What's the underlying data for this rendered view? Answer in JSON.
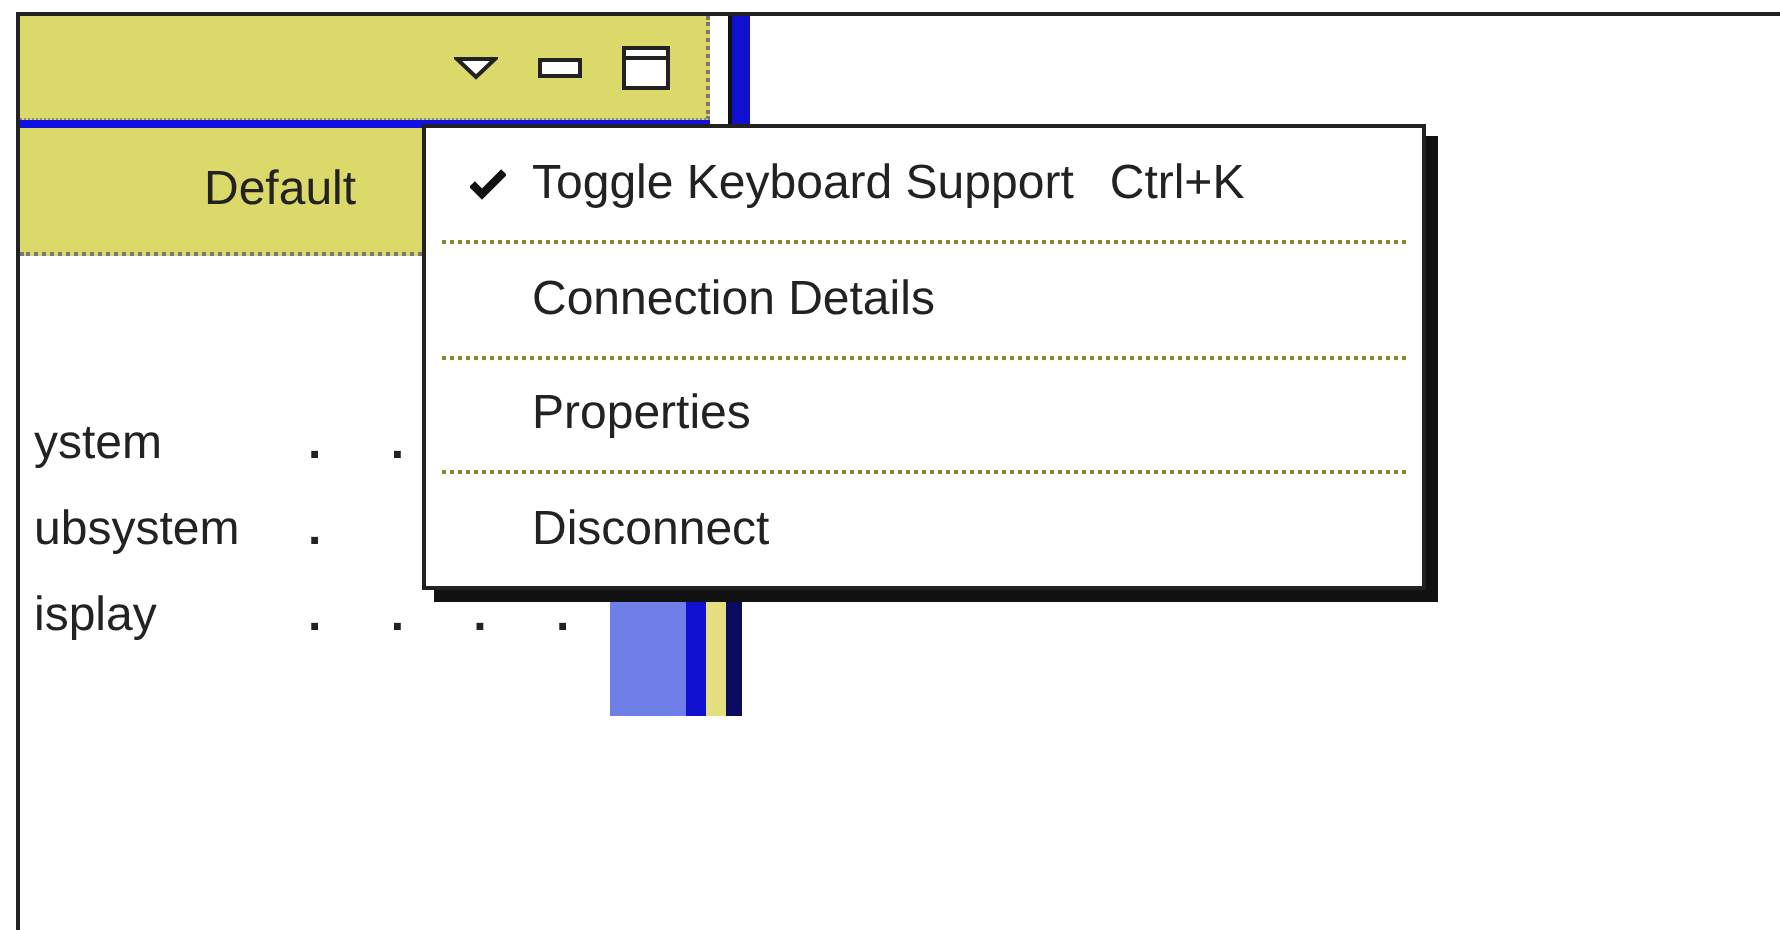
{
  "view": {
    "tab_label": "Default",
    "rows": [
      {
        "label": "ystem",
        "dots": ". ."
      },
      {
        "label": "ubsystem",
        "dots": "."
      },
      {
        "label": "isplay",
        "dots": ". . . ."
      }
    ]
  },
  "context_menu": {
    "items": [
      {
        "label": "Toggle Keyboard Support",
        "shortcut": "Ctrl+K",
        "checked": true
      },
      {
        "label": "Connection Details",
        "checked": false
      },
      {
        "label": "Properties",
        "checked": false
      },
      {
        "label": "Disconnect",
        "checked": false
      }
    ]
  }
}
